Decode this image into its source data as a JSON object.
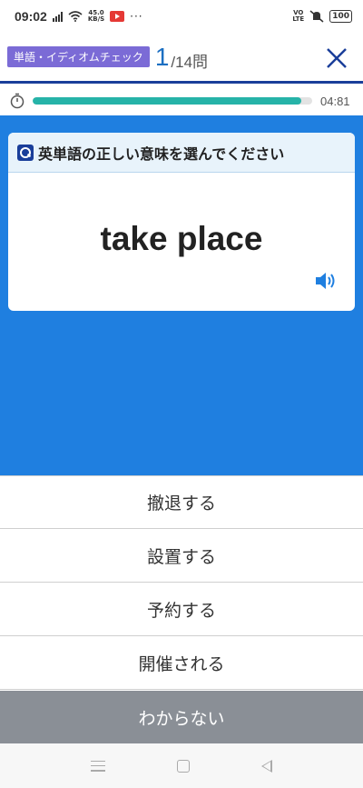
{
  "status_bar": {
    "time": "09:02",
    "net_speed_value": "45.0",
    "net_speed_unit": "KB/S",
    "more_indicator": "···",
    "volte_top": "VO",
    "volte_bottom": "LTE",
    "battery": "100"
  },
  "header": {
    "badge": "単語・イディオムチェック",
    "current_question": "1",
    "total_questions": "/14問"
  },
  "timer": {
    "progress_fraction": 0.96,
    "time_left": "04:81"
  },
  "question": {
    "instruction": "英単語の正しい意味を選んでください",
    "word": "take place"
  },
  "answers": [
    {
      "label": "撤退する"
    },
    {
      "label": "設置する"
    },
    {
      "label": "予約する"
    },
    {
      "label": "開催される"
    }
  ],
  "dont_know_label": "わからない",
  "colors": {
    "accent_blue": "#1f7fe0",
    "badge_purple": "#7b6bd6",
    "progress_teal": "#26b3a8",
    "dont_know_gray": "#8a8f96"
  }
}
